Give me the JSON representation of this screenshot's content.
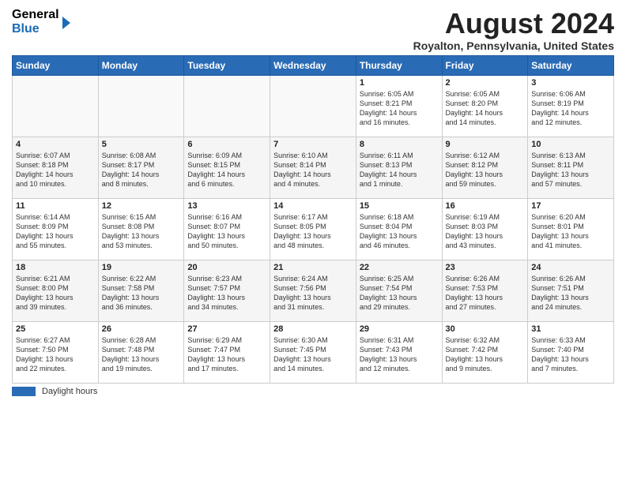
{
  "header": {
    "logo_general": "General",
    "logo_blue": "Blue",
    "month_title": "August 2024",
    "location": "Royalton, Pennsylvania, United States"
  },
  "days_of_week": [
    "Sunday",
    "Monday",
    "Tuesday",
    "Wednesday",
    "Thursday",
    "Friday",
    "Saturday"
  ],
  "footer": {
    "bar_label": "Daylight hours"
  },
  "weeks": [
    {
      "days": [
        {
          "num": "",
          "info": ""
        },
        {
          "num": "",
          "info": ""
        },
        {
          "num": "",
          "info": ""
        },
        {
          "num": "",
          "info": ""
        },
        {
          "num": "1",
          "info": "Sunrise: 6:05 AM\nSunset: 8:21 PM\nDaylight: 14 hours\nand 16 minutes."
        },
        {
          "num": "2",
          "info": "Sunrise: 6:05 AM\nSunset: 8:20 PM\nDaylight: 14 hours\nand 14 minutes."
        },
        {
          "num": "3",
          "info": "Sunrise: 6:06 AM\nSunset: 8:19 PM\nDaylight: 14 hours\nand 12 minutes."
        }
      ]
    },
    {
      "days": [
        {
          "num": "4",
          "info": "Sunrise: 6:07 AM\nSunset: 8:18 PM\nDaylight: 14 hours\nand 10 minutes."
        },
        {
          "num": "5",
          "info": "Sunrise: 6:08 AM\nSunset: 8:17 PM\nDaylight: 14 hours\nand 8 minutes."
        },
        {
          "num": "6",
          "info": "Sunrise: 6:09 AM\nSunset: 8:15 PM\nDaylight: 14 hours\nand 6 minutes."
        },
        {
          "num": "7",
          "info": "Sunrise: 6:10 AM\nSunset: 8:14 PM\nDaylight: 14 hours\nand 4 minutes."
        },
        {
          "num": "8",
          "info": "Sunrise: 6:11 AM\nSunset: 8:13 PM\nDaylight: 14 hours\nand 1 minute."
        },
        {
          "num": "9",
          "info": "Sunrise: 6:12 AM\nSunset: 8:12 PM\nDaylight: 13 hours\nand 59 minutes."
        },
        {
          "num": "10",
          "info": "Sunrise: 6:13 AM\nSunset: 8:11 PM\nDaylight: 13 hours\nand 57 minutes."
        }
      ]
    },
    {
      "days": [
        {
          "num": "11",
          "info": "Sunrise: 6:14 AM\nSunset: 8:09 PM\nDaylight: 13 hours\nand 55 minutes."
        },
        {
          "num": "12",
          "info": "Sunrise: 6:15 AM\nSunset: 8:08 PM\nDaylight: 13 hours\nand 53 minutes."
        },
        {
          "num": "13",
          "info": "Sunrise: 6:16 AM\nSunset: 8:07 PM\nDaylight: 13 hours\nand 50 minutes."
        },
        {
          "num": "14",
          "info": "Sunrise: 6:17 AM\nSunset: 8:05 PM\nDaylight: 13 hours\nand 48 minutes."
        },
        {
          "num": "15",
          "info": "Sunrise: 6:18 AM\nSunset: 8:04 PM\nDaylight: 13 hours\nand 46 minutes."
        },
        {
          "num": "16",
          "info": "Sunrise: 6:19 AM\nSunset: 8:03 PM\nDaylight: 13 hours\nand 43 minutes."
        },
        {
          "num": "17",
          "info": "Sunrise: 6:20 AM\nSunset: 8:01 PM\nDaylight: 13 hours\nand 41 minutes."
        }
      ]
    },
    {
      "days": [
        {
          "num": "18",
          "info": "Sunrise: 6:21 AM\nSunset: 8:00 PM\nDaylight: 13 hours\nand 39 minutes."
        },
        {
          "num": "19",
          "info": "Sunrise: 6:22 AM\nSunset: 7:58 PM\nDaylight: 13 hours\nand 36 minutes."
        },
        {
          "num": "20",
          "info": "Sunrise: 6:23 AM\nSunset: 7:57 PM\nDaylight: 13 hours\nand 34 minutes."
        },
        {
          "num": "21",
          "info": "Sunrise: 6:24 AM\nSunset: 7:56 PM\nDaylight: 13 hours\nand 31 minutes."
        },
        {
          "num": "22",
          "info": "Sunrise: 6:25 AM\nSunset: 7:54 PM\nDaylight: 13 hours\nand 29 minutes."
        },
        {
          "num": "23",
          "info": "Sunrise: 6:26 AM\nSunset: 7:53 PM\nDaylight: 13 hours\nand 27 minutes."
        },
        {
          "num": "24",
          "info": "Sunrise: 6:26 AM\nSunset: 7:51 PM\nDaylight: 13 hours\nand 24 minutes."
        }
      ]
    },
    {
      "days": [
        {
          "num": "25",
          "info": "Sunrise: 6:27 AM\nSunset: 7:50 PM\nDaylight: 13 hours\nand 22 minutes."
        },
        {
          "num": "26",
          "info": "Sunrise: 6:28 AM\nSunset: 7:48 PM\nDaylight: 13 hours\nand 19 minutes."
        },
        {
          "num": "27",
          "info": "Sunrise: 6:29 AM\nSunset: 7:47 PM\nDaylight: 13 hours\nand 17 minutes."
        },
        {
          "num": "28",
          "info": "Sunrise: 6:30 AM\nSunset: 7:45 PM\nDaylight: 13 hours\nand 14 minutes."
        },
        {
          "num": "29",
          "info": "Sunrise: 6:31 AM\nSunset: 7:43 PM\nDaylight: 13 hours\nand 12 minutes."
        },
        {
          "num": "30",
          "info": "Sunrise: 6:32 AM\nSunset: 7:42 PM\nDaylight: 13 hours\nand 9 minutes."
        },
        {
          "num": "31",
          "info": "Sunrise: 6:33 AM\nSunset: 7:40 PM\nDaylight: 13 hours\nand 7 minutes."
        }
      ]
    }
  ]
}
